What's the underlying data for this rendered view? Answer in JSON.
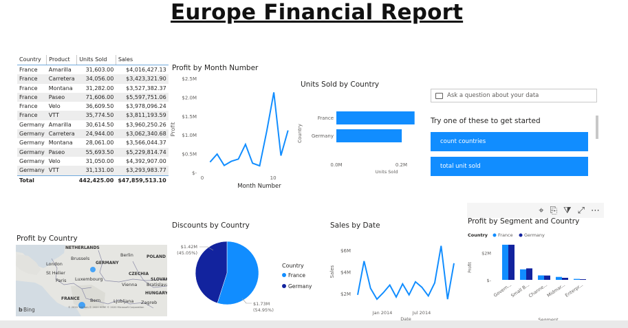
{
  "report": {
    "title": "Europe Financial Report"
  },
  "table": {
    "headers": [
      "Country",
      "Product",
      "Units Sold",
      "Sales"
    ],
    "rows": [
      [
        "France",
        "Amarilla",
        "31,603.00",
        "$4,016,427.13"
      ],
      [
        "France",
        "Carretera",
        "34,056.00",
        "$3,423,321.90"
      ],
      [
        "France",
        "Montana",
        "31,282.00",
        "$3,527,382.37"
      ],
      [
        "France",
        "Paseo",
        "71,606.00",
        "$5,597,751.06"
      ],
      [
        "France",
        "Velo",
        "36,609.50",
        "$3,978,096.24"
      ],
      [
        "France",
        "VTT",
        "35,774.50",
        "$3,811,193.59"
      ],
      [
        "Germany",
        "Amarilla",
        "30,614.50",
        "$3,960,250.26"
      ],
      [
        "Germany",
        "Carretera",
        "24,944.00",
        "$3,062,340.68"
      ],
      [
        "Germany",
        "Montana",
        "28,061.00",
        "$3,566,044.37"
      ],
      [
        "Germany",
        "Paseo",
        "55,693.50",
        "$5,229,814.74"
      ],
      [
        "Germany",
        "Velo",
        "31,050.00",
        "$4,392,907.00"
      ],
      [
        "Germany",
        "VTT",
        "31,131.00",
        "$3,293,983.77"
      ]
    ],
    "total": [
      "Total",
      "",
      "442,425.00",
      "$47,859,513.10"
    ]
  },
  "profit_by_month": {
    "title": "Profit by Month Number",
    "y_ticks": [
      "$2.5M",
      "$2.0M",
      "$1.5M",
      "$1.0M",
      "$0.5M",
      "$-"
    ],
    "x_ticks": [
      "0",
      "10"
    ],
    "xlabel": "Month Number",
    "ylabel": "Profit"
  },
  "units_by_country": {
    "title": "Units Sold by Country",
    "x_ticks": [
      "0.0M",
      "0.2M"
    ],
    "xlabel": "Units Sold",
    "ylabel": "Country"
  },
  "qa": {
    "placeholder": "Ask a question about your data",
    "hint": "Try one of these to get started",
    "suggestions": [
      "count countries",
      "total unit sold"
    ]
  },
  "profit_by_country": {
    "title": "Profit by Country"
  },
  "map": {
    "labels": [
      "NETHERLANDS",
      "Brussels",
      "London",
      "GERMANY",
      "Berlin",
      "POLAND",
      "St Helier",
      "Paris",
      "Luxembourg",
      "CZECHIA",
      "SLOVAKIA",
      "Vienna",
      "Bratislava",
      "HUNGARY",
      "FRANCE",
      "Bern",
      "Ljubljana",
      "Zagreb"
    ],
    "credit": "Bing",
    "copyright": "© 2020 TomTom © 2020 HERE © 2020 Microsoft Corporation"
  },
  "discounts_by_country": {
    "title": "Discounts by Country",
    "legend_title": "Country",
    "label_germany": "$1.42M",
    "pct_germany": "(45.05%)",
    "label_france": "$1.73M",
    "pct_france": "(54.95%)"
  },
  "sales_by_date": {
    "title": "Sales by Date",
    "y_ticks": [
      "$6M",
      "$4M",
      "$2M"
    ],
    "x_ticks": [
      "Jan 2014",
      "Jul 2014"
    ],
    "xlabel": "Date",
    "ylabel": "Sales"
  },
  "profit_by_segment": {
    "title": "Profit by Segment and Country",
    "legend_title": "Country",
    "legend": [
      "France",
      "Germany"
    ],
    "y_ticks": [
      "$2M",
      "$-"
    ],
    "xlabel": "Segment",
    "ylabel": "Profit"
  },
  "colors": {
    "accent": "#118dff",
    "dark": "#12239e",
    "line": "#118dff"
  },
  "chart_data": [
    {
      "type": "line",
      "title": "Profit by Month Number",
      "xlabel": "Month Number",
      "ylabel": "Profit",
      "x": [
        1,
        2,
        3,
        4,
        5,
        6,
        7,
        8,
        9,
        10,
        11,
        12
      ],
      "series": [
        {
          "values": [
            0.28,
            0.49,
            0.19,
            0.3,
            0.36,
            0.75,
            0.25,
            0.18,
            1.1,
            2.13,
            0.45,
            1.12
          ]
        }
      ],
      "ylim": [
        0,
        2.5
      ],
      "units": "$M"
    },
    {
      "type": "bar",
      "title": "Units Sold by Country",
      "orientation": "horizontal",
      "categories": [
        "France",
        "Germany"
      ],
      "values": [
        240931,
        201494
      ],
      "xlabel": "Units Sold",
      "ylabel": "Country"
    },
    {
      "type": "pie",
      "title": "Discounts by Country",
      "categories": [
        "France",
        "Germany"
      ],
      "values": [
        1.73,
        1.42
      ],
      "percent": [
        54.95,
        45.05
      ],
      "units": "$M"
    },
    {
      "type": "line",
      "title": "Sales by Date",
      "xlabel": "Date",
      "ylabel": "Sales",
      "series": [
        {
          "values": [
            1.9,
            5.0,
            2.5,
            1.5,
            2.1,
            2.8,
            1.7,
            2.9,
            1.9,
            3.1,
            2.6,
            1.8,
            3.0,
            6.4,
            1.5,
            4.8
          ]
        }
      ],
      "units": "$M"
    },
    {
      "type": "bar",
      "title": "Profit by Segment and Country",
      "categories": [
        "Government",
        "Small Business",
        "Channel Partners",
        "Midmarket",
        "Enterprise"
      ],
      "series": [
        {
          "name": "France",
          "values": [
            2.6,
            0.78,
            0.33,
            0.22,
            0.07
          ]
        },
        {
          "name": "Germany",
          "values": [
            2.6,
            0.85,
            0.32,
            0.15,
            0.05
          ]
        }
      ],
      "xlabel": "Segment",
      "ylabel": "Profit",
      "units": "$M"
    }
  ]
}
